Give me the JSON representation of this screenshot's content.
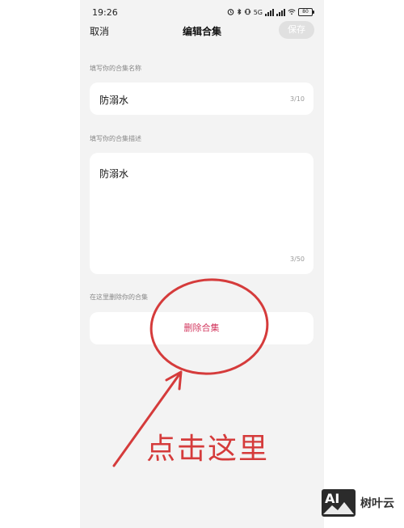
{
  "status_bar": {
    "time": "19:26",
    "network_label": "5G",
    "battery_level": "80"
  },
  "nav": {
    "cancel_label": "取消",
    "title": "编辑合集",
    "save_label": "保存"
  },
  "name_section": {
    "label": "填写你的合集名称",
    "value": "防溺水",
    "counter": "3/10"
  },
  "description_section": {
    "label": "填写你的合集描述",
    "value": "防溺水",
    "counter": "3/50"
  },
  "delete_section": {
    "label": "在这里删除你的合集",
    "button_label": "删除合集"
  },
  "annotation": {
    "callout": "点击这里",
    "color": "#d53b3b"
  },
  "watermark": {
    "logo_text": "AI",
    "brand": "树叶云"
  },
  "colors": {
    "background": "#f3f3f3",
    "card": "#ffffff",
    "delete_text": "#d2385f",
    "save_disabled": "#e0e0e0"
  }
}
